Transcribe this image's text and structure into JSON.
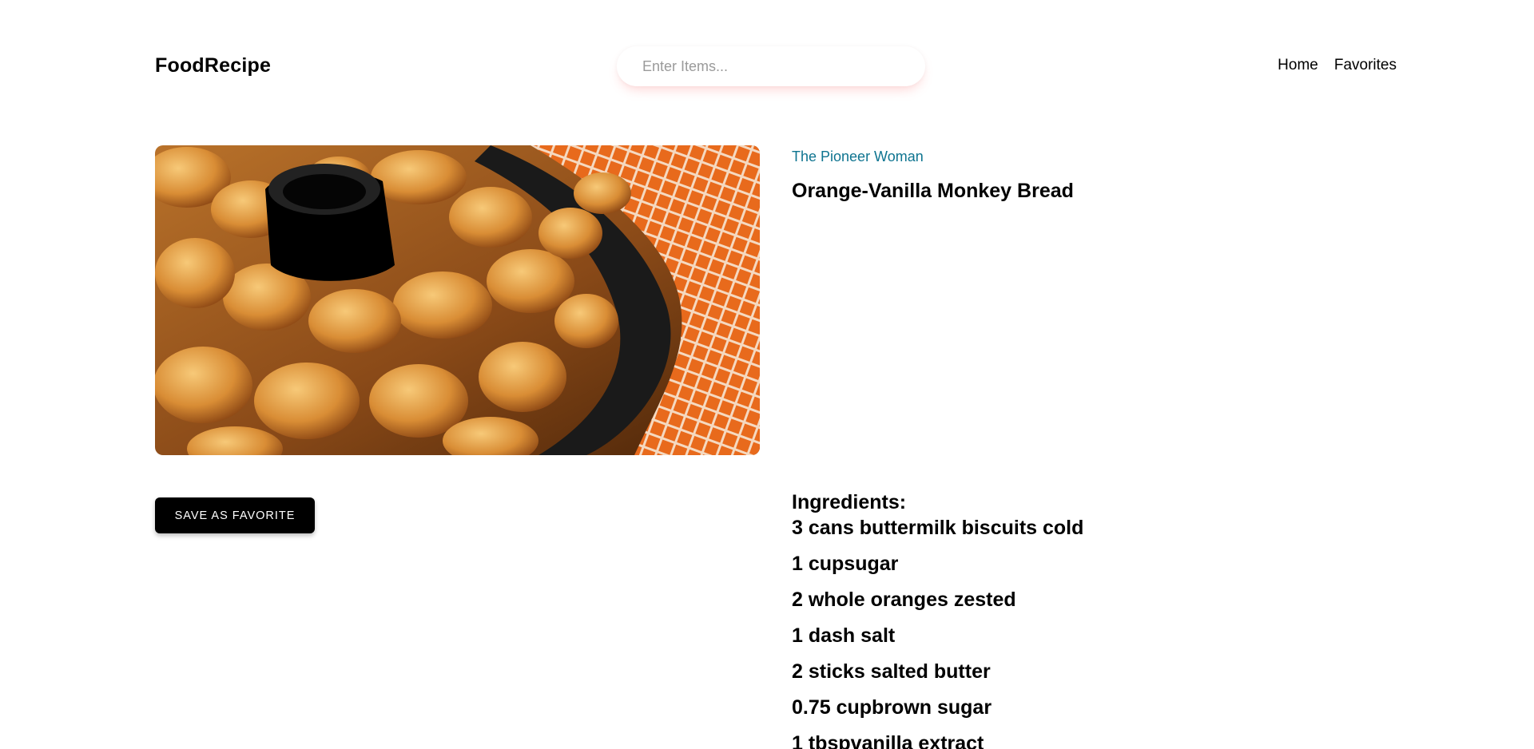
{
  "navbar": {
    "logo": "FoodRecipe",
    "search": {
      "placeholder": "Enter Items...",
      "value": ""
    },
    "links": [
      {
        "label": "Home"
      },
      {
        "label": "Favorites"
      }
    ]
  },
  "recipe": {
    "publisher": "The Pioneer Woman",
    "title": "Orange-Vanilla Monkey Bread",
    "save_button_label": "SAVE AS FAVORITE",
    "ingredients_heading": "Ingredients:",
    "ingredients": [
      "3 cans buttermilk biscuits cold",
      "1 cupsugar",
      "2 whole oranges zested",
      "1 dash salt",
      "2 sticks salted butter",
      "0.75 cupbrown sugar",
      "1 tbspvanilla extract"
    ]
  },
  "colors": {
    "publisher": "#0e7490",
    "button_bg": "#000000",
    "search_shadow": "#ff6e6e"
  }
}
